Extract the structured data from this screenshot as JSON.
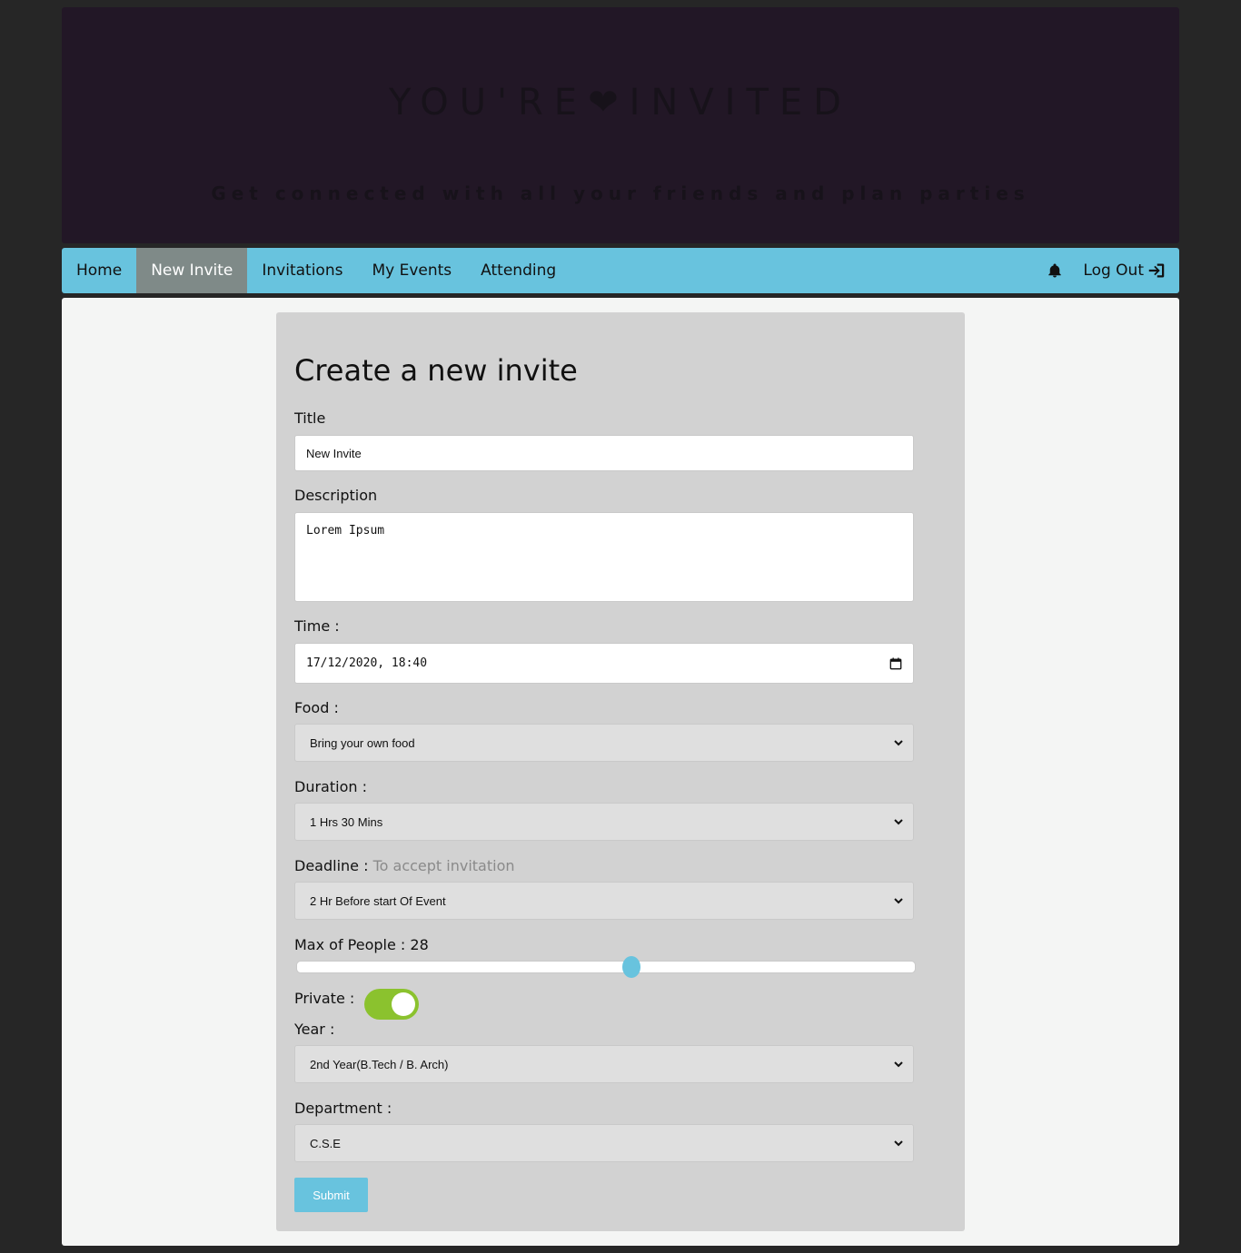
{
  "hero": {
    "brand_left": "YOU'RE",
    "brand_heart": "❤",
    "brand_right": "INVITED",
    "tagline": "Get connected with all your friends and plan parties"
  },
  "nav": {
    "items": [
      {
        "label": "Home",
        "active": false
      },
      {
        "label": "New Invite",
        "active": true
      },
      {
        "label": "Invitations",
        "active": false
      },
      {
        "label": "My Events",
        "active": false
      },
      {
        "label": "Attending",
        "active": false
      }
    ],
    "notifications_icon": "bell-icon",
    "logout_label": "Log Out",
    "logout_icon": "sign-in-icon"
  },
  "form": {
    "heading": "Create a new invite",
    "title_label": "Title",
    "title_value": "New Invite",
    "description_label": "Description",
    "description_value": "Lorem Ipsum",
    "time_label": "Time :",
    "time_value": "17/12/2020, 18:40",
    "food_label": "Food :",
    "food_value": "Bring your own food",
    "duration_label": "Duration :",
    "duration_value": "1 Hrs 30 Mins",
    "deadline_label": "Deadline :",
    "deadline_hint": "To accept invitation",
    "deadline_value": "2 Hr Before start Of Event",
    "max_people_label": "Max of People : 28",
    "max_people_fraction": 0.54,
    "private_label": "Private :",
    "private_on": true,
    "year_label": "Year :",
    "year_value": "2nd Year(B.Tech / B. Arch)",
    "department_label": "Department :",
    "department_value": "C.S.E",
    "submit_label": "Submit"
  },
  "colors": {
    "accent": "#68c3de",
    "toggle_on": "#8bc22e",
    "hero_bg": "#221726",
    "nav_active": "#7f8a88"
  }
}
